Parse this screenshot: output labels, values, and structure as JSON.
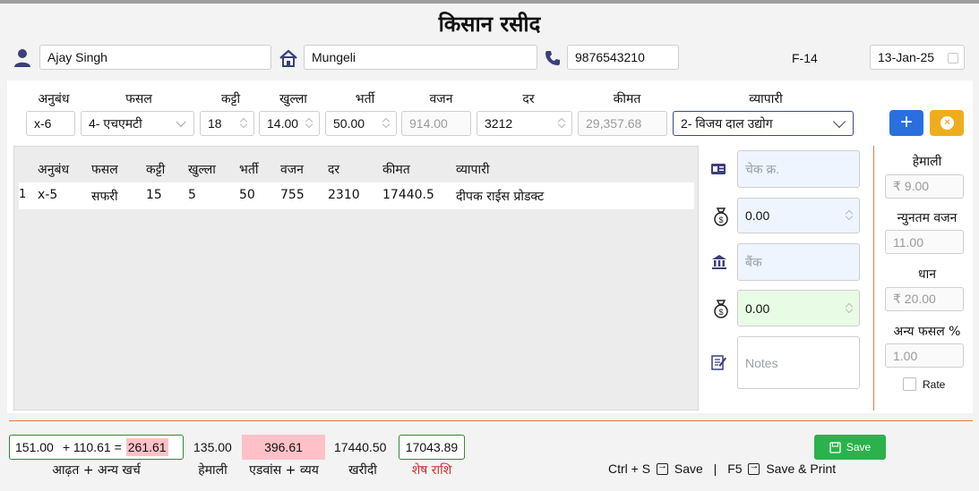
{
  "title": "किसान रसीद",
  "header": {
    "farmer_name": "Ajay Singh",
    "village": "Mungeli",
    "phone": "9876543210",
    "receipt_no": "F-14",
    "date": "13-Jan-25"
  },
  "entry": {
    "labels": {
      "anubandh": "अनुबंध",
      "fasal": "फसल",
      "katti": "कट्टी",
      "khulla": "खुल्ला",
      "bharti": "भर्ती",
      "vajan": "वजन",
      "dar": "दर",
      "keemat": "कीमत",
      "vyapari": "व्यापारी"
    },
    "values": {
      "anubandh": "x-6",
      "fasal": "4- एचएमटी",
      "katti": "18",
      "khulla": "14.00",
      "bharti": "50.00",
      "vajan": "914.00",
      "dar": "3212",
      "keemat": "29,357.68",
      "vyapari": "2- विजय दाल उद्योग"
    },
    "add_button": "+"
  },
  "table": {
    "headers": [
      "अनुबंध",
      "फसल",
      "कट्टी",
      "खुल्ला",
      "भर्ती",
      "वजन",
      "दर",
      "कीमत",
      "व्यापारी"
    ],
    "rows": [
      {
        "index": "1",
        "cells": [
          "x-5",
          "सफरी",
          "15",
          "5",
          "50",
          "755",
          "2310",
          "17440.5",
          "दीपक राईस प्रोडक्ट"
        ]
      }
    ]
  },
  "payment": {
    "cheque_placeholder": "चेक क्र.",
    "amount1": "0.00",
    "bank_placeholder": "बैंक",
    "amount2": "0.00",
    "notes_placeholder": "Notes"
  },
  "settings": {
    "hamali_label": "हेमाली",
    "hamali_value": "₹ 9.00",
    "min_weight_label": "न्युनतम वजन",
    "min_weight_value": "11.00",
    "dhan_label": "धान",
    "dhan_value": "₹ 20.00",
    "other_crop_label": "अन्य फसल %",
    "other_crop_value": "1.00",
    "rate_label": "Rate"
  },
  "summary": {
    "aadhat": "151.00",
    "plus_expense": "+ 110.61 =",
    "aadhat_total": "261.61",
    "aadhat_label": "आढ़त + अन्य खर्च",
    "hamali": "135.00",
    "hamali_label": "हेमाली",
    "advance": "396.61",
    "advance_label": "एडवांस + व्यय",
    "purchase": "17440.50",
    "purchase_label": "खरीदी",
    "balance": "17043.89",
    "balance_label": "शेष राशि"
  },
  "actions": {
    "save_label": "Save",
    "shortcut_save_key": "Ctrl + S",
    "shortcut_save_label": "Save",
    "separator": "|",
    "shortcut_print_key": "F5",
    "shortcut_print_label": "Save & Print"
  },
  "colors": {
    "accent_blue": "#2a6fe0",
    "cancel_yellow": "#efad1e",
    "save_green": "#2bb24c",
    "balance_red": "#d0312d",
    "highlight_pink": "#ffc1c7",
    "divider_orange": "#e07a4a"
  }
}
